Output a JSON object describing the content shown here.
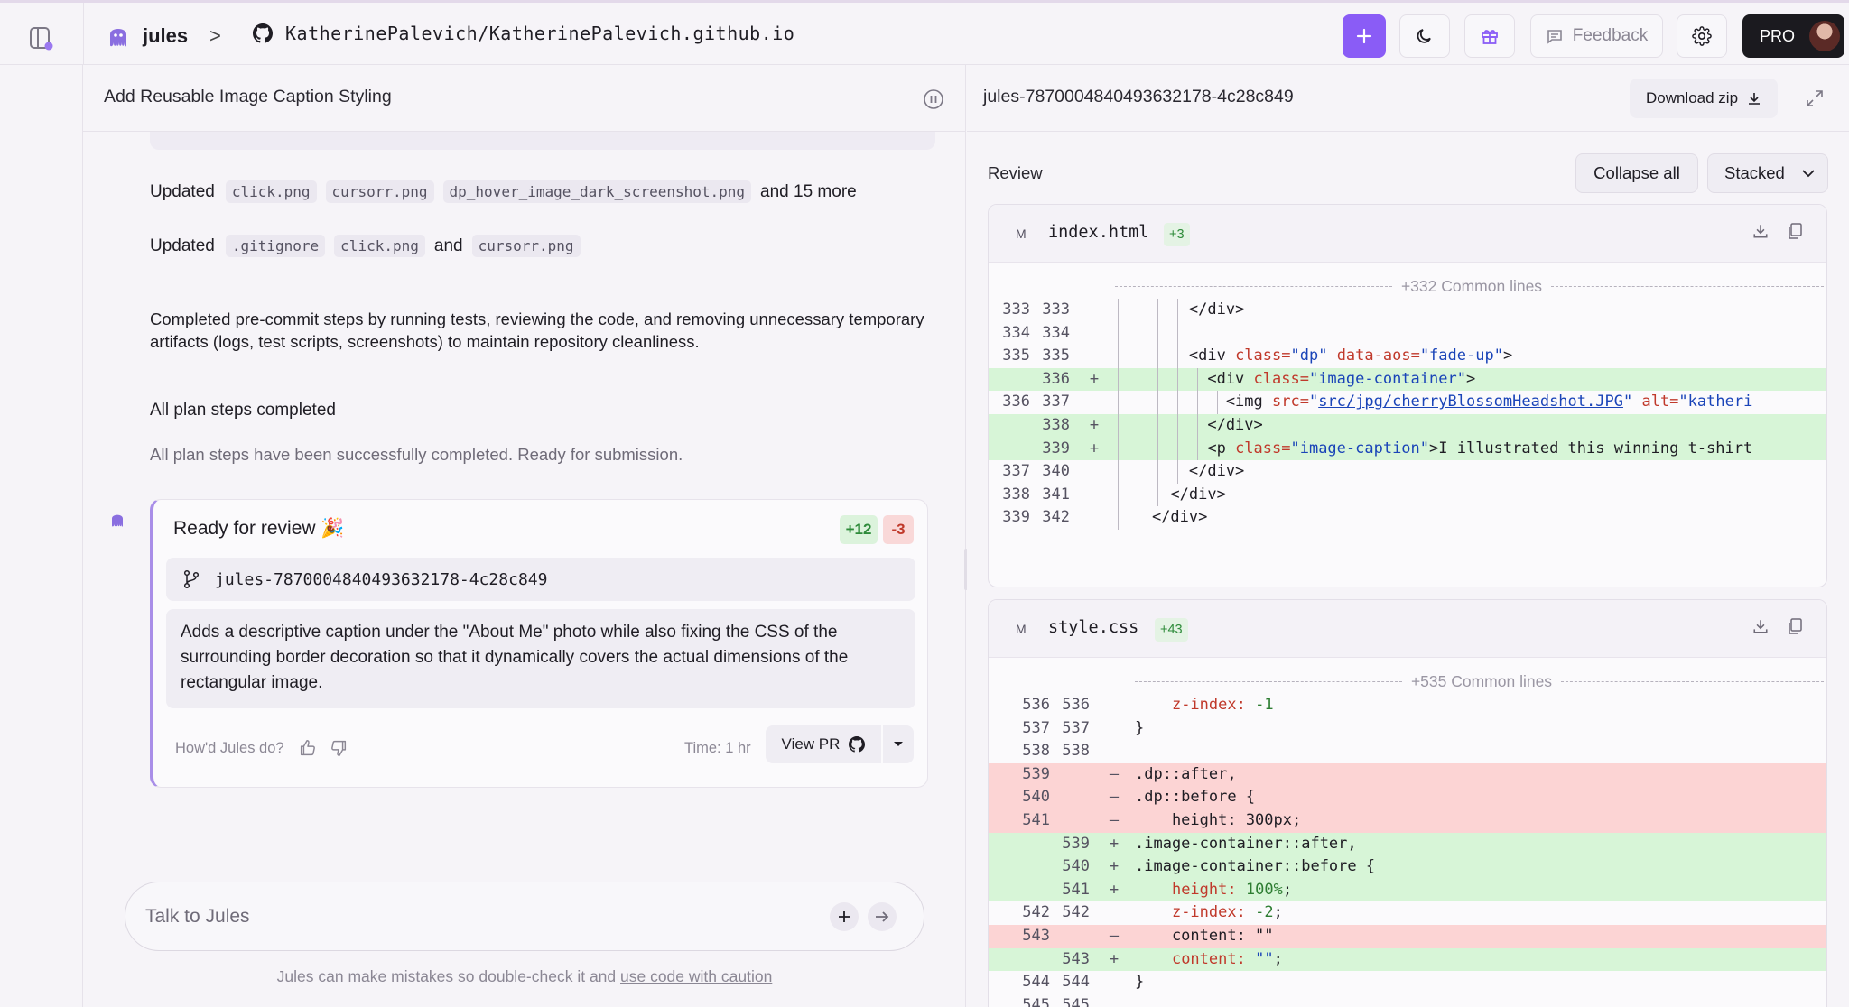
{
  "app": {
    "brand": "jules",
    "breadcrumb_separator": ">",
    "repo": "KatherinePalevich/KatherinePalevich.github.io",
    "feedback_label": "Feedback",
    "pro_label": "PRO",
    "accent_color": "#8a5cf6"
  },
  "chat": {
    "task_title": "Add Reusable Image Caption Styling",
    "updated_label": "Updated",
    "updated_row_1": {
      "files": [
        "click.png",
        "cursorr.png",
        "dp_hover_image_dark_screenshot.png"
      ],
      "more": "and 15 more"
    },
    "updated_row_2": {
      "files": [
        ".gitignore",
        "click.png",
        "cursorr.png"
      ],
      "and": "and"
    },
    "summary": "Completed pre-commit steps by running tests, reviewing the code, and removing unnecessary temporary artifacts (logs, test scripts, screenshots) to maintain repository cleanliness.",
    "plan_title": "All plan steps completed",
    "plan_sub": "All plan steps have been successfully completed. Ready for submission.",
    "review_card": {
      "title": "Ready for review 🎉",
      "additions": "+12",
      "deletions": "-3",
      "branch": "jules-7870004840493632178-4c28c849",
      "description": "Adds a descriptive caption under the \"About Me\" photo while also fixing the CSS of the surrounding border decoration so that it dynamically covers the actual dimensions of the rectangular image.",
      "rating_label": "How'd Jules do?",
      "time_label": "Time: 1 hr",
      "view_pr_label": "View PR"
    },
    "input_placeholder": "Talk to Jules",
    "disclaimer_text": "Jules can make mistakes so double-check it and ",
    "disclaimer_link": "use code with caution"
  },
  "review": {
    "branch": "jules-7870004840493632178-4c28c849",
    "download_label": "Download zip",
    "section_label": "Review",
    "collapse_label": "Collapse all",
    "view_mode": "Stacked",
    "files": [
      {
        "status": "M",
        "name": "index.html",
        "count": "+3",
        "common": "+332 Common lines"
      },
      {
        "status": "M",
        "name": "style.css",
        "count": "+43",
        "common": "+535 Common lines"
      }
    ]
  }
}
